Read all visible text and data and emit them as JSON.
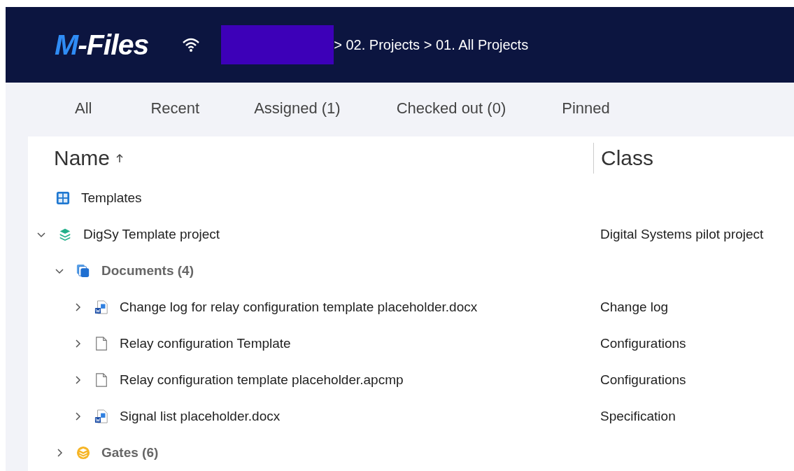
{
  "header": {
    "logo": {
      "accent": "M",
      "rest": "-Files"
    },
    "breadcrumb": {
      "redacted": true,
      "path": "> 02. Projects > 01. All Projects"
    }
  },
  "tabs": [
    {
      "label": "All",
      "selected": false
    },
    {
      "label": "Recent",
      "selected": false
    },
    {
      "label": "Assigned (1)",
      "selected": false
    },
    {
      "label": "Checked out (0)",
      "selected": false
    },
    {
      "label": "Pinned",
      "selected": false
    }
  ],
  "table": {
    "columns": [
      {
        "label": "Name",
        "sorted_ascending": true
      },
      {
        "label": "Class"
      }
    ],
    "rows": [
      {
        "kind": "view",
        "name": "Templates"
      },
      {
        "kind": "project",
        "name": "DigSy Template project",
        "class": "Digital Systems pilot project",
        "expanded": true,
        "children": [
          {
            "kind": "document-group",
            "name": "Documents (4)",
            "expanded": true,
            "children": [
              {
                "kind": "word-document",
                "name": "Change log for relay configuration template placeholder.docx",
                "class": "Change log",
                "expanded": false
              },
              {
                "kind": "file",
                "name": "Relay configuration Template",
                "class": "Configurations",
                "expanded": false
              },
              {
                "kind": "file",
                "name": "Relay configuration template placeholder.apcmp",
                "class": "Configurations",
                "expanded": false
              },
              {
                "kind": "word-document",
                "name": "Signal list placeholder.docx",
                "class": "Specification",
                "expanded": false
              }
            ]
          },
          {
            "kind": "gate-group",
            "name": "Gates (6)",
            "expanded": false
          }
        ]
      }
    ]
  }
}
